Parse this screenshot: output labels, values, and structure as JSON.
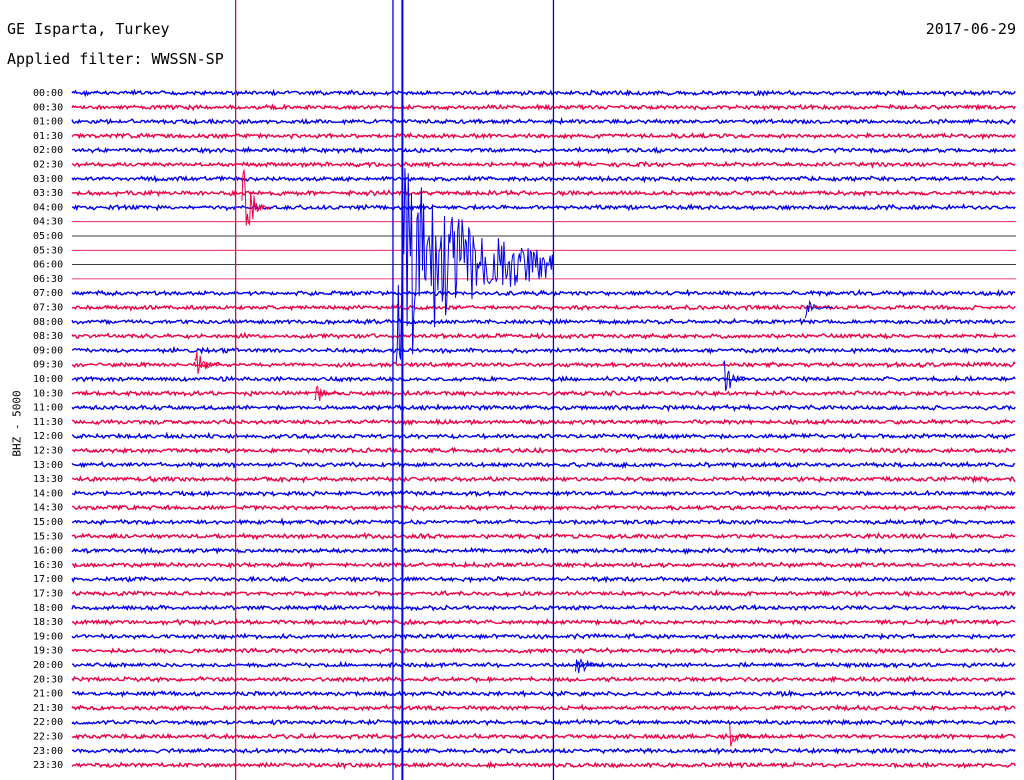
{
  "header": {
    "station": "GE Isparta, Turkey",
    "filter": "Applied filter: WWSSN-SP",
    "date": "2017-06-29"
  },
  "chart_data": {
    "type": "line",
    "title": "GE Isparta, Turkey",
    "subtitle": "Applied filter: WWSSN-SP",
    "date": "2017-06-29",
    "ylabel": "BHZ - 5000",
    "row_labels": [
      "00:00",
      "00:30",
      "01:00",
      "01:30",
      "02:00",
      "02:30",
      "03:00",
      "03:30",
      "04:00",
      "04:30",
      "05:00",
      "05:30",
      "06:00",
      "06:30",
      "07:00",
      "07:30",
      "08:00",
      "08:30",
      "09:00",
      "09:30",
      "10:00",
      "10:30",
      "11:00",
      "11:30",
      "12:00",
      "12:30",
      "13:00",
      "13:30",
      "14:00",
      "14:30",
      "15:00",
      "15:30",
      "16:00",
      "16:30",
      "17:00",
      "17:30",
      "18:00",
      "18:30",
      "19:00",
      "19:30",
      "20:00",
      "20:30",
      "21:00",
      "21:30",
      "22:00",
      "22:30",
      "23:00",
      "23:30"
    ],
    "row_colors": [
      "#0000ee",
      "#ee0044"
    ],
    "x_range_minutes": [
      0,
      30
    ],
    "gap_rows": [
      "04:30",
      "05:00",
      "05:30",
      "06:00",
      "06:30"
    ],
    "vertical_markers_minutes": [
      5.2,
      10.2,
      10.5,
      15.3
    ],
    "events": [
      {
        "row": "04:00",
        "minute": 5.4,
        "amplitude": 4,
        "color": "#ee0044"
      },
      {
        "row": "06:00",
        "minute": 10.3,
        "duration": 5.0,
        "amplitude": 8,
        "color": "#0000ee"
      },
      {
        "row": "09:30",
        "minute": 3.9,
        "amplitude": 1.3,
        "color": "#ee0044"
      },
      {
        "row": "10:00",
        "minute": 20.7,
        "amplitude": 1.5,
        "color": "#0000ee"
      },
      {
        "row": "10:30",
        "minute": 7.7,
        "amplitude": 1.1,
        "color": "#ee0044"
      },
      {
        "row": "07:30",
        "minute": 23.3,
        "amplitude": 0.8,
        "color": "#0000ee"
      },
      {
        "row": "20:00",
        "minute": 16.0,
        "amplitude": 1.4,
        "color": "#0000ee"
      },
      {
        "row": "22:30",
        "minute": 20.9,
        "amplitude": 0.9,
        "color": "#ee0044"
      }
    ]
  }
}
